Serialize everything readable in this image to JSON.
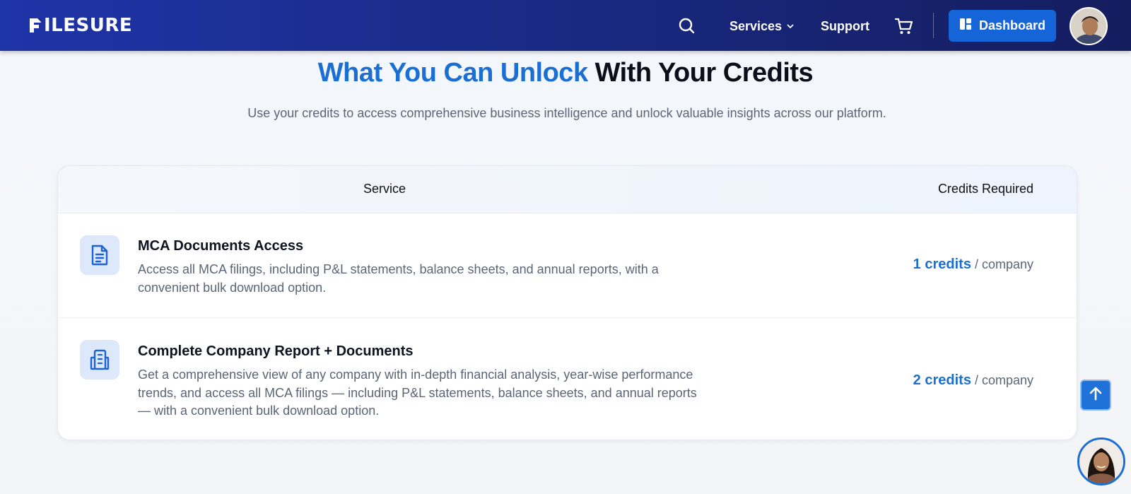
{
  "header": {
    "logo_text": "ILESURE",
    "nav": {
      "services_label": "Services",
      "support_label": "Support",
      "dashboard_label": "Dashboard"
    },
    "icons": [
      "search-icon",
      "chevron-down-icon",
      "cart-icon",
      "dashboard-icon",
      "user-avatar"
    ]
  },
  "hero": {
    "title_highlight": "What You Can Unlock",
    "title_rest": "With Your Credits",
    "subtitle": "Use your credits to access comprehensive business intelligence and unlock valuable insights across our platform."
  },
  "table": {
    "headers": {
      "service": "Service",
      "credits": "Credits Required"
    },
    "rows": [
      {
        "icon": "document-icon",
        "title": "MCA Documents Access",
        "description": "Access all MCA filings, including P&L statements, balance sheets, and annual reports, with a convenient bulk download option.",
        "credits": "1 credits",
        "unit": "/ company"
      },
      {
        "icon": "building-icon",
        "title": "Complete Company Report + Documents",
        "description": "Get a comprehensive view of any company with in-depth financial analysis, year-wise performance trends, and access all MCA filings — including P&L statements, balance sheets, and annual reports — with a convenient bulk download option.",
        "credits": "2 credits",
        "unit": "/ company"
      }
    ]
  },
  "floating": {
    "scroll_top_icon": "arrow-up-icon",
    "chat_avatar": "support-agent-avatar"
  },
  "colors": {
    "accent": "#1b6fd3",
    "header_start": "#1e35a8",
    "header_end": "#141d5e",
    "muted_text": "#5b6577"
  }
}
